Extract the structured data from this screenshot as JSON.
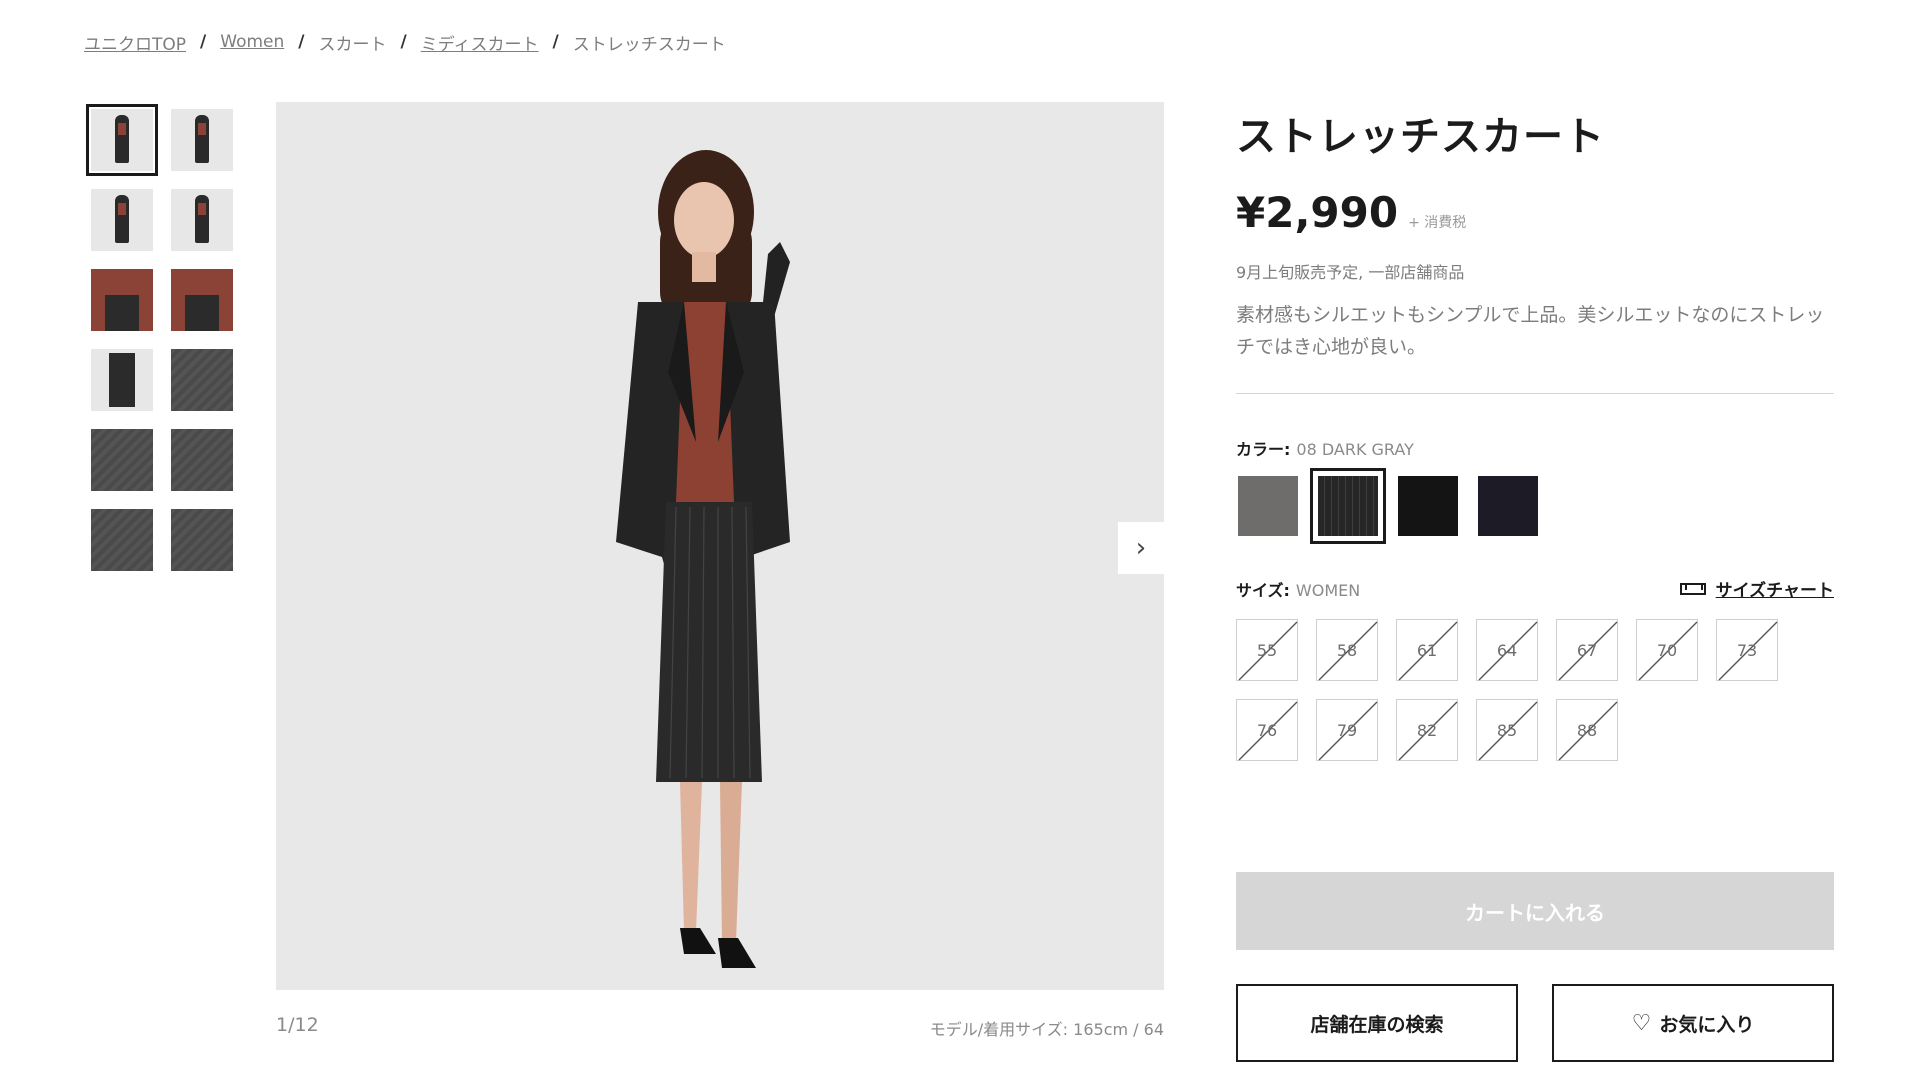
{
  "breadcrumb": {
    "items": [
      "ユニクロTOP",
      "Women",
      "スカート",
      "ミディスカート",
      "ストレッチスカート"
    ],
    "separator": "/"
  },
  "gallery": {
    "counter": "1/12",
    "model_size": "モデル/着用サイズ: 165cm / 64",
    "next_icon": "›"
  },
  "product": {
    "title": "ストレッチスカート",
    "price": "¥2,990",
    "tax_note": "+ 消費税",
    "availability": "9月上旬販売予定, 一部店舗商品",
    "description": "素材感もシルエットもシンプルで上品。美シルエットなのにストレッチではき心地が良い。"
  },
  "color": {
    "label": "カラー:",
    "selected": "08 DARK GRAY",
    "swatches": [
      "#6f6d6b",
      "#262626",
      "#141414",
      "#1c1b26"
    ]
  },
  "size": {
    "label": "サイズ:",
    "category": "WOMEN",
    "chart_label": "サイズチャート",
    "options": [
      "55",
      "58",
      "61",
      "64",
      "67",
      "70",
      "73",
      "76",
      "79",
      "82",
      "85",
      "88"
    ]
  },
  "actions": {
    "cart": "カートに入れる",
    "store_search": "店舗在庫の検索",
    "favorite": "お気に入り",
    "favorite_icon": "♡"
  },
  "colors": {
    "disabled_button": "#d6d6d6",
    "text": "#1b1b1b",
    "muted": "#7d7d7d"
  }
}
